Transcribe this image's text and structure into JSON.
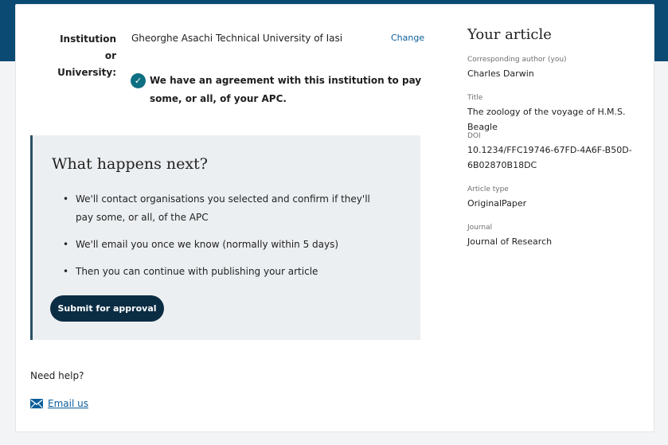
{
  "institution": {
    "label": "Institution or University:",
    "value": "Gheorghe Asachi Technical University of Iasi",
    "change_label": "Change",
    "agreement_text": "We have an agreement with this institution to pay some, or all, of your APC."
  },
  "next_steps": {
    "title": "What happens next?",
    "items": [
      "We'll contact organisations you selected and confirm if they'll pay some, or all, of the APC",
      "We'll email you once we know (normally within 5 days)",
      "Then you can continue with publishing your article"
    ],
    "submit_label": "Submit for approval"
  },
  "help": {
    "title": "Need help?",
    "email_label": "Email us"
  },
  "article": {
    "title": "Your article",
    "author_label": "Corresponding author (you)",
    "author_value": "Charles Darwin",
    "title_label": "Title",
    "title_value": "The zoology of the voyage of H.M.S. Beagle",
    "doi_label": "DOI",
    "doi_value": "10.1234/FFC19746-67FD-4A6F-B50D-6B02870B18DC",
    "type_label": "Article type",
    "type_value": "OriginalPaper",
    "journal_label": "Journal",
    "journal_value": "Journal of Research"
  },
  "icons": {
    "check": "check-circle-icon",
    "mail": "envelope-icon"
  },
  "colors": {
    "header_band": "#0a4a73",
    "button": "#0b2d44",
    "link": "#0b5e9b",
    "check": "#0f6f82",
    "next_box_bg": "#eceff1"
  }
}
